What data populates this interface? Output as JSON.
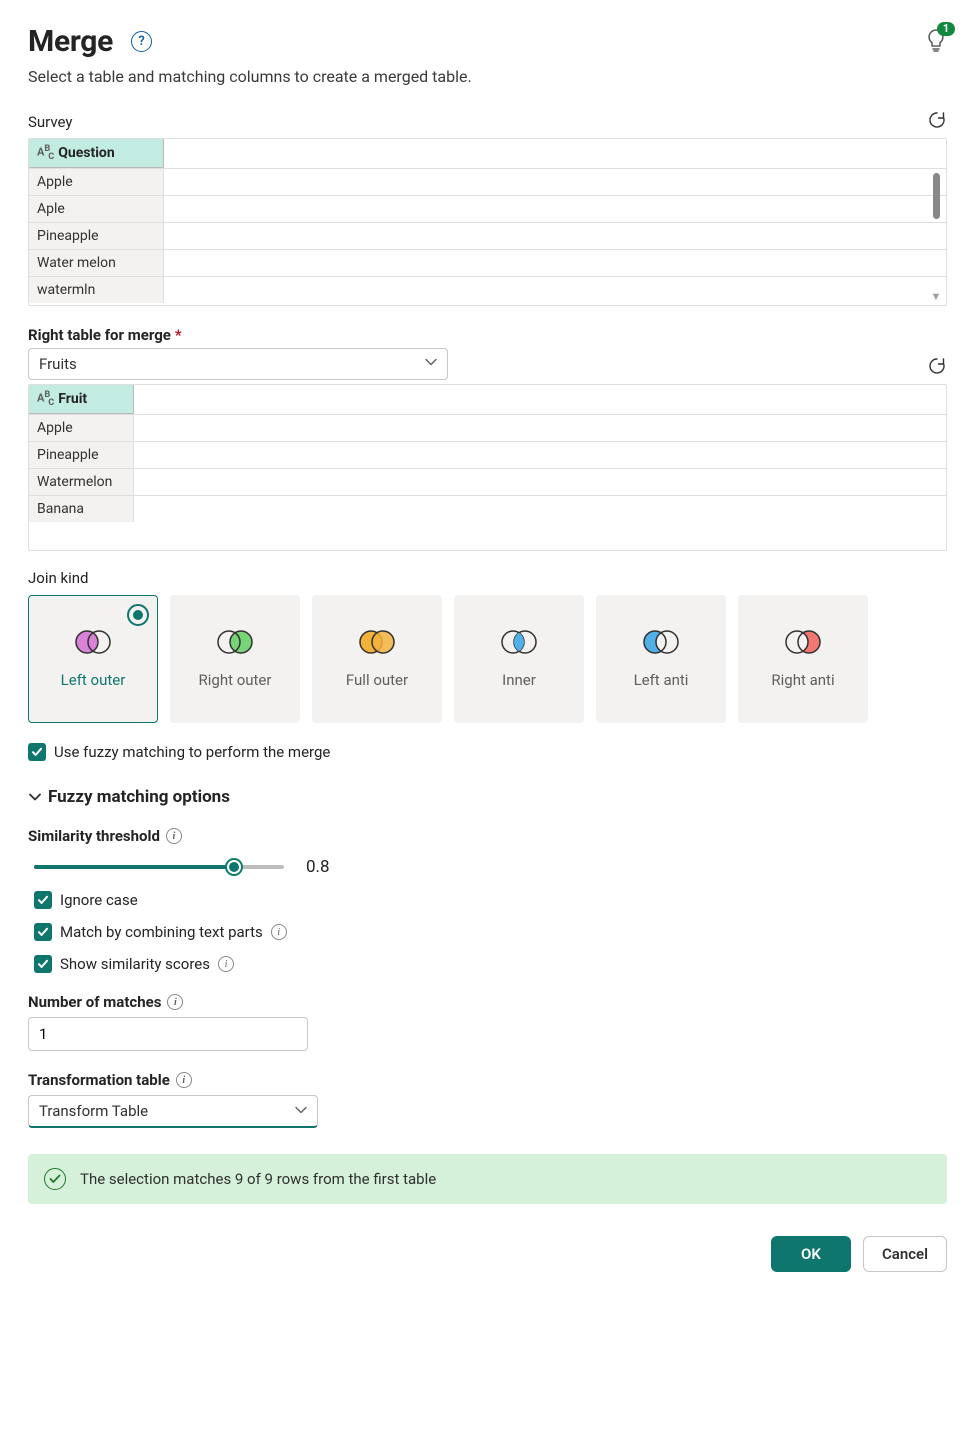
{
  "header": {
    "title": "Merge",
    "subtitle": "Select a table and matching columns to create a merged table.",
    "tipCount": "1"
  },
  "leftTable": {
    "name": "Survey",
    "columnHeader": "Question",
    "rows": [
      "Apple",
      "Aple",
      "Pineapple",
      "Water melon",
      "watermln"
    ]
  },
  "rightTableField": {
    "label": "Right table for merge",
    "value": "Fruits",
    "columnHeader": "Fruit",
    "rows": [
      "Apple",
      "Pineapple",
      "Watermelon",
      "Banana"
    ]
  },
  "joinKind": {
    "label": "Join kind",
    "options": [
      "Left outer",
      "Right outer",
      "Full outer",
      "Inner",
      "Left anti",
      "Right anti"
    ],
    "selected": "Left outer"
  },
  "fuzzy": {
    "checkbox": "Use fuzzy matching to perform the merge",
    "sectionTitle": "Fuzzy matching options",
    "threshold": {
      "label": "Similarity threshold",
      "value": "0.8"
    },
    "ignoreCase": "Ignore case",
    "combineParts": "Match by combining text parts",
    "showScores": "Show similarity scores",
    "numMatches": {
      "label": "Number of matches",
      "value": "1"
    },
    "transformTable": {
      "label": "Transformation table",
      "value": "Transform Table"
    }
  },
  "banner": "The selection matches 9 of 9 rows from the first table",
  "footer": {
    "ok": "OK",
    "cancel": "Cancel"
  }
}
